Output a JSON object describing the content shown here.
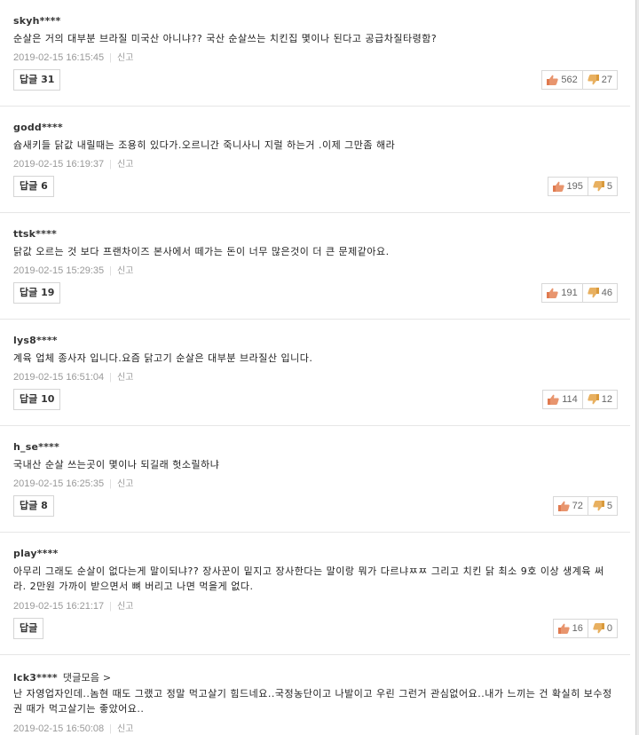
{
  "report_label": "신고",
  "comments": [
    {
      "author": "skyh****",
      "text": "순살은 거의 대부분 브라질 미국산 아니냐?? 국산 순살쓰는 치킨집 몇이나 된다고 공급차질타령함?",
      "date": "2019-02-15 16:15:45",
      "reply_label": "답글 31",
      "likes": "562",
      "dislikes": "27"
    },
    {
      "author": "godd****",
      "text": "슙새키들 닭값 내릴때는 조용히 있다가.오르니간 죽니사니 지럴 하는거 .이제 그만좀 해라",
      "date": "2019-02-15 16:19:37",
      "reply_label": "답글 6",
      "likes": "195",
      "dislikes": "5"
    },
    {
      "author": "ttsk****",
      "text": "닭값 오르는 것 보다 프랜차이즈 본사에서 떼가는 돈이 너무 많은것이 더 큰 문제같아요.",
      "date": "2019-02-15 15:29:35",
      "reply_label": "답글 19",
      "likes": "191",
      "dislikes": "46"
    },
    {
      "author": "lys8****",
      "text": "계육 업체 종사자 입니다.요즘 닭고기 순살은 대부분 브라질산 입니다.",
      "date": "2019-02-15 16:51:04",
      "reply_label": "답글 10",
      "likes": "114",
      "dislikes": "12"
    },
    {
      "author": "h_se****",
      "text": "국내산 순살 쓰는곳이 몇이나 되길래 헛소릴하냐",
      "date": "2019-02-15 16:25:35",
      "reply_label": "답글 8",
      "likes": "72",
      "dislikes": "5"
    },
    {
      "author": "play****",
      "text": "아무리 그래도 순살이 없다는게 말이되냐?? 장사꾼이 밑지고 장사한다는 말이랑 뭐가 다르냐ㅉㅉ 그리고 치킨 닭 최소 9호 이상 생계육 써라. 2만원 가까이 받으면서 뼈 버리고 나면 먹을게 없다.",
      "date": "2019-02-15 16:21:17",
      "reply_label": "답글",
      "likes": "16",
      "dislikes": "0"
    },
    {
      "author": "lck3****",
      "author_extra": "댓글모음 >",
      "text": "난 자영업자인데..놈현 때도 그랬고 정말 먹고살기 힘드네요..국정농단이고 나발이고 우린 그런거 관심없어요..내가 느끼는 건 확실히 보수정권 때가 먹고살기는 좋았어요..",
      "date": "2019-02-15 16:50:08",
      "reply_label": "",
      "likes": "",
      "dislikes": ""
    }
  ]
}
